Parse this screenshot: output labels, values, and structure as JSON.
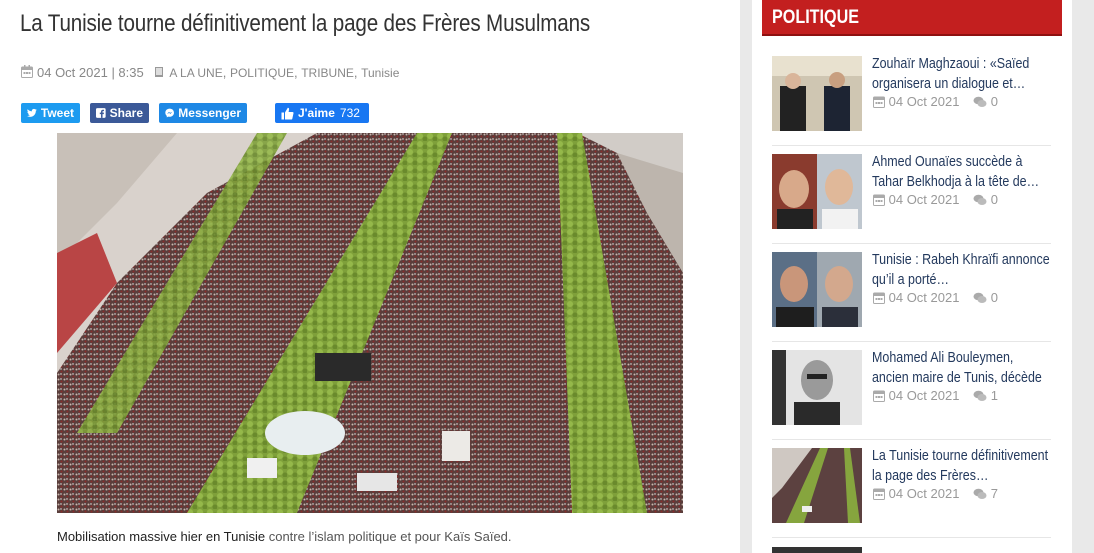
{
  "article": {
    "title": "La Tunisie tourne définitivement la page des Frères Musulmans",
    "date": "04 Oct 2021 | 8:35",
    "categories": [
      "A LA UNE",
      "POLITIQUE",
      "TRIBUNE",
      "Tunisie"
    ],
    "caption_main": "Mobilisation massive hier en Tunisie",
    "caption_rest": " contre l’islam politique et pour Kaïs Saïed."
  },
  "share": {
    "tweet": "Tweet",
    "share": "Share",
    "messenger": "Messenger",
    "like": "J'aime",
    "like_count": "732"
  },
  "sidebar": {
    "heading": "POLITIQUE",
    "items": [
      {
        "title": "Zouhaïr Maghzaoui : «Saïed organisera un dialogue et…",
        "date": "04 Oct 2021",
        "comments": "0"
      },
      {
        "title": "Ahmed Ounaïes succède à Tahar Belkhodja à la tête de…",
        "date": "04 Oct 2021",
        "comments": "0"
      },
      {
        "title": "Tunisie : Rabeh Khraïfi annonce qu’il a porté…",
        "date": "04 Oct 2021",
        "comments": "0"
      },
      {
        "title": "Mohamed Ali Bouleymen, ancien maire de Tunis, décède",
        "date": "04 Oct 2021",
        "comments": "1"
      },
      {
        "title": "La Tunisie tourne définitivement la page des Frères…",
        "date": "04 Oct 2021",
        "comments": "7"
      }
    ]
  },
  "colors": {
    "accent_red": "#c31f1f",
    "link_blue": "#23395d",
    "twitter": "#1d9bf0",
    "facebook": "#3b5998"
  }
}
